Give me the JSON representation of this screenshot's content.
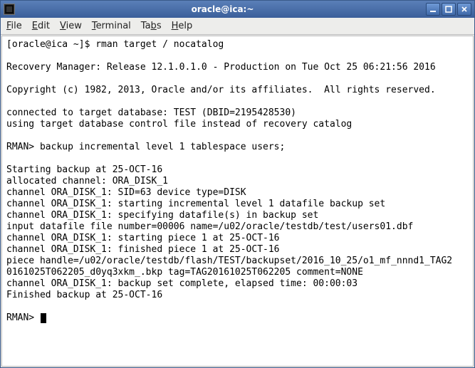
{
  "window": {
    "title": "oracle@ica:~"
  },
  "menu": {
    "file": "File",
    "edit": "Edit",
    "view": "View",
    "terminal": "Terminal",
    "tabs": "Tabs",
    "help": "Help"
  },
  "terminal": {
    "lines": [
      "[oracle@ica ~]$ rman target / nocatalog",
      "",
      "Recovery Manager: Release 12.1.0.1.0 - Production on Tue Oct 25 06:21:56 2016",
      "",
      "Copyright (c) 1982, 2013, Oracle and/or its affiliates.  All rights reserved.",
      "",
      "connected to target database: TEST (DBID=2195428530)",
      "using target database control file instead of recovery catalog",
      "",
      "RMAN> backup incremental level 1 tablespace users;",
      "",
      "Starting backup at 25-OCT-16",
      "allocated channel: ORA_DISK_1",
      "channel ORA_DISK_1: SID=63 device type=DISK",
      "channel ORA_DISK_1: starting incremental level 1 datafile backup set",
      "channel ORA_DISK_1: specifying datafile(s) in backup set",
      "input datafile file number=00006 name=/u02/oracle/testdb/test/users01.dbf",
      "channel ORA_DISK_1: starting piece 1 at 25-OCT-16",
      "channel ORA_DISK_1: finished piece 1 at 25-OCT-16",
      "piece handle=/u02/oracle/testdb/flash/TEST/backupset/2016_10_25/o1_mf_nnnd1_TAG2",
      "0161025T062205_d0yq3xkm_.bkp tag=TAG20161025T062205 comment=NONE",
      "channel ORA_DISK_1: backup set complete, elapsed time: 00:00:03",
      "Finished backup at 25-OCT-16",
      "",
      "RMAN> "
    ]
  }
}
